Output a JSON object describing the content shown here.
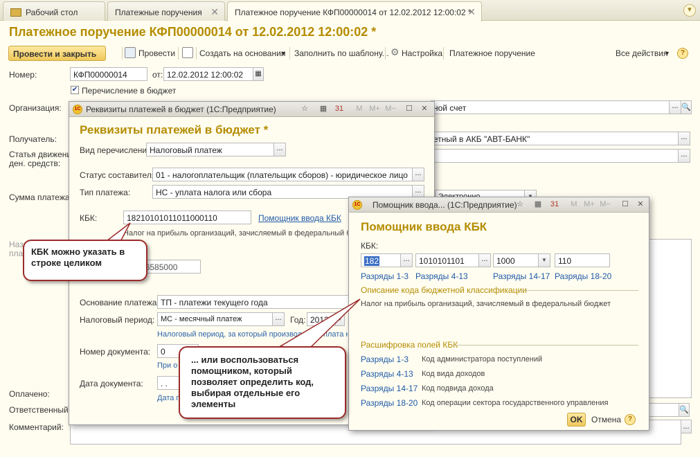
{
  "tabs": [
    {
      "label": "Рабочий стол"
    },
    {
      "label": "Платежные поручения"
    },
    {
      "label": "Платежное поручение КФП00000014 от 12.02.2012 12:00:02 *"
    }
  ],
  "main": {
    "title": "Платежное поручение КФП00000014 от 12.02.2012 12:00:02 *",
    "toolbar": {
      "post_close": "Провести и закрыть",
      "post": "Провести",
      "create_based": "Создать на основании",
      "fill_template": "Заполнить по шаблону...",
      "settings": "Настройка",
      "payment_order": "Платежное поручение",
      "all_actions": "Все действия"
    },
    "labels": {
      "number": "Номер:",
      "from": "от:",
      "budget_transfer": "Перечисление в бюджет",
      "organization": "Организация:",
      "recipient": "Получатель:",
      "cash_flow_1": "Статья движения",
      "cash_flow_2": "ден. средств:",
      "amount": "Сумма платежа:",
      "purpose_1": "Назначение",
      "purpose_2": "платежа:",
      "paid": "Оплачено:",
      "responsible": "Ответственный:",
      "comment": "Комментарий:"
    },
    "values": {
      "number": "КФП00000014",
      "date": "12.02.2012 12:00:02",
      "org_tail": "ной счет",
      "recipient_tail": "етный в АКБ \"АВТ-БАНК\"",
      "amount_tail": "Электронно"
    }
  },
  "budget_window": {
    "title": "Реквизиты платежей в бюджет (1С:Предприятие)",
    "heading": "Реквизиты платежей в бюджет *",
    "labels": {
      "transfer_kind": "Вид перечисления:",
      "composer_status": "Статус составителя:",
      "payment_type": "Тип платежа:",
      "kbk": "КБК:",
      "payment_basis": "Основание платежа:",
      "tax_period": "Налоговый период:",
      "year": "Год:",
      "doc_number": "Номер документа:",
      "doc_date": "Дата документа:"
    },
    "values": {
      "transfer_kind": "Налоговый платеж",
      "composer_status": "01 - налогоплательщик (плательщик сборов) - юридическое лицо",
      "payment_type": "НС - уплата налога или сбора",
      "kbk": "18210101011011000110",
      "kbk_description": "Налог на прибыль организаций, зачисляемый в федеральный б",
      "oktmo": "45286585000",
      "oktmo_prefix": "О",
      "payment_basis": "ТП - платежи текущего года",
      "tax_period": "МС - месячный платеж",
      "year": "2012",
      "doc_number": "0",
      "doc_date": ". .",
      "tax_period_hint": "Налоговый период, за который производится уплата н",
      "doc_number_hint": "При о",
      "doc_date_hint": "Дата подп"
    },
    "kbk_helper_link": "Помощник ввода КБК"
  },
  "kbk_window": {
    "title": "Помощник ввода... (1С:Предприятие)",
    "heading": "Помощник ввода КБК",
    "kbk_label": "КБК:",
    "fields": [
      {
        "value": "182",
        "caption": "Разряды 1-3"
      },
      {
        "value": "1010101101",
        "caption": "Разряды 4-13"
      },
      {
        "value": "1000",
        "caption": "Разряды 14-17"
      },
      {
        "value": "110",
        "caption": "Разряды 18-20"
      }
    ],
    "desc_section": "Описание кода бюджетной классификации",
    "description": "Налог на прибыль организаций, зачисляемый в федеральный бюджет",
    "decode_section": "Расшифровка полей КБК",
    "decode": [
      {
        "range": "Разряды 1-3",
        "meaning": "Код администратора поступлений"
      },
      {
        "range": "Разряды 4-13",
        "meaning": "Код вида доходов"
      },
      {
        "range": "Разряды 14-17",
        "meaning": "Код подвида дохода"
      },
      {
        "range": "Разряды 18-20",
        "meaning": "Код операции сектора государственного управления"
      }
    ],
    "ok": "OK",
    "cancel": "Отмена"
  },
  "callouts": {
    "first": "КБК можно указать в строке целиком",
    "second": "... или воспользоваться помощником, который позволяет определить код, выбирая отдельные его элементы"
  },
  "colors": {
    "accent": "#b48c00",
    "link": "#1f5aa8",
    "callout_border": "#9b2a2a"
  }
}
